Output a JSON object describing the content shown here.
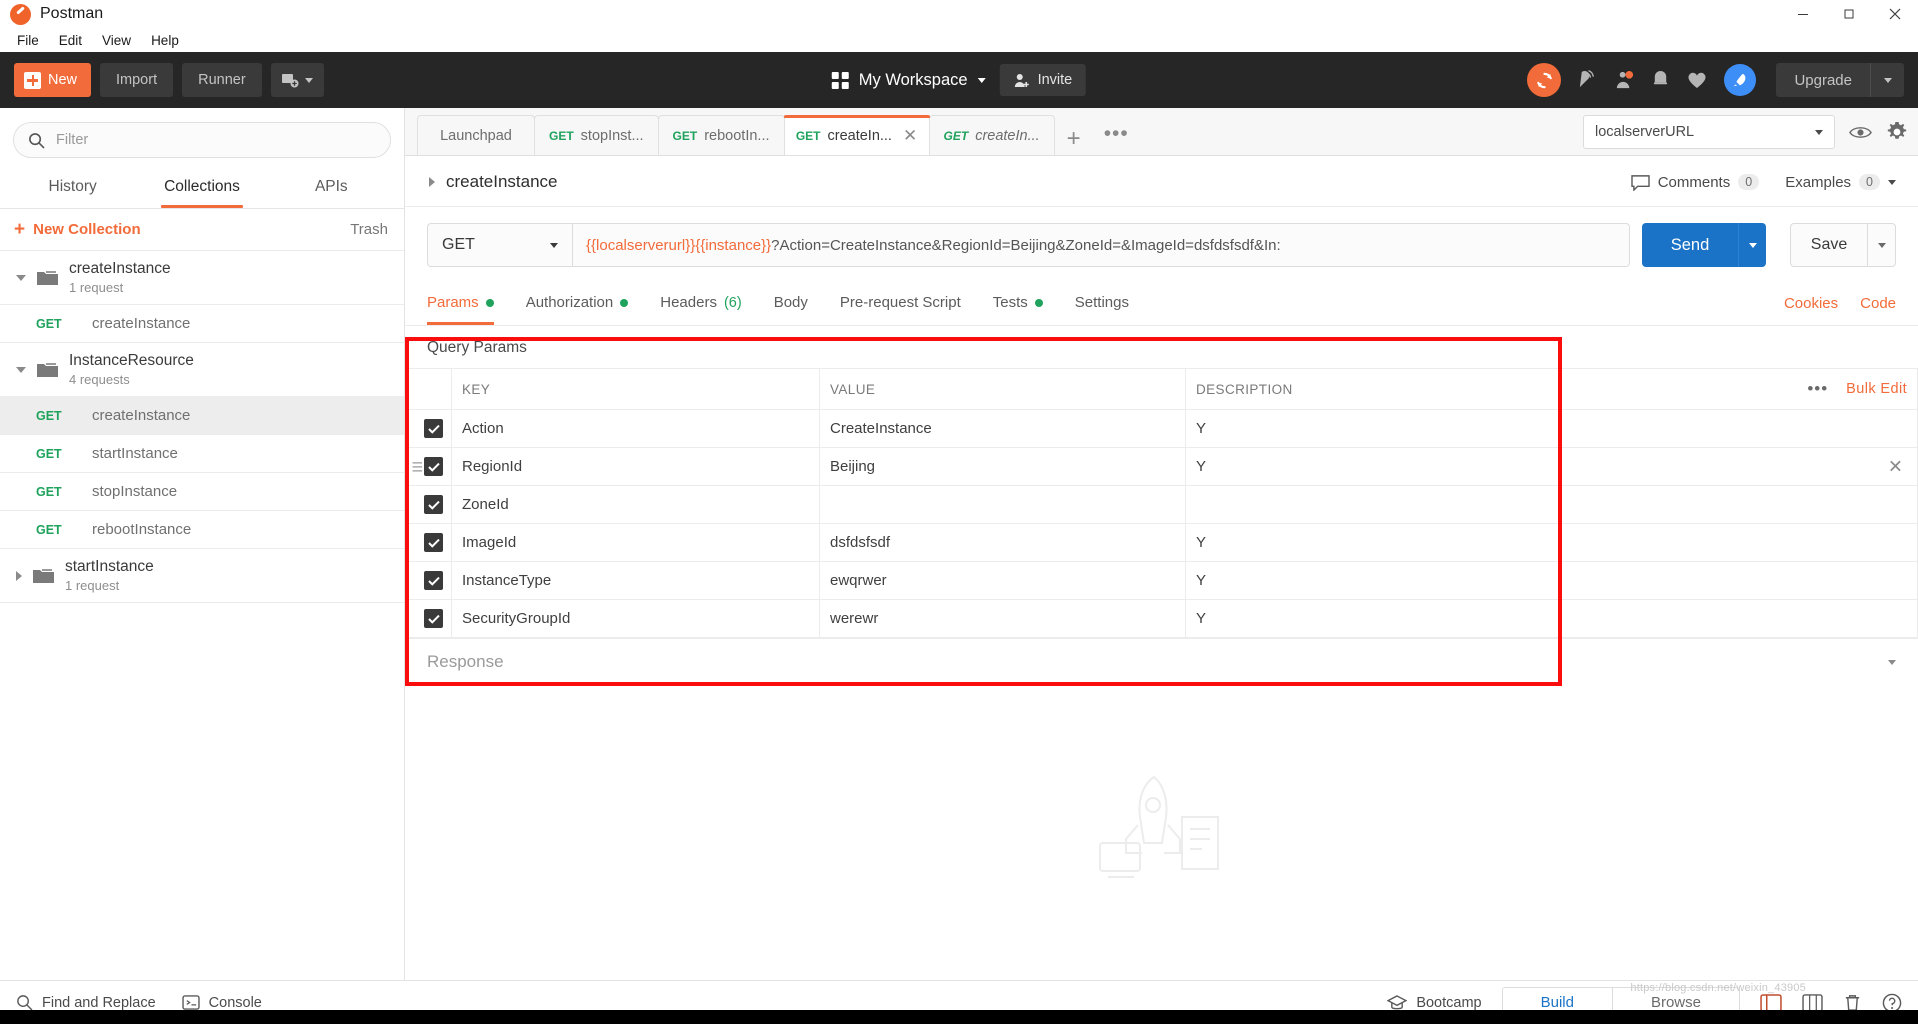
{
  "window": {
    "app_title": "Postman",
    "logo_icon": "postman-logo-icon",
    "minimize": "—",
    "maximize": "❐",
    "close": "✕"
  },
  "menubar": {
    "items": [
      "File",
      "Edit",
      "View",
      "Help"
    ]
  },
  "toolbar": {
    "new_label": "New",
    "import_label": "Import",
    "runner_label": "Runner",
    "workspace_label": "My Workspace",
    "invite_label": "Invite",
    "upgrade_label": "Upgrade",
    "icons": [
      "sync-icon",
      "satellite-icon",
      "notifications-icon",
      "bell-icon",
      "heart-icon",
      "rocket-icon"
    ],
    "accent_color": "#f26b3a"
  },
  "sidebar": {
    "filter_placeholder": "Filter",
    "filter_value": "",
    "tabs": [
      {
        "label": "History",
        "active": false
      },
      {
        "label": "Collections",
        "active": true
      },
      {
        "label": "APIs",
        "active": false
      }
    ],
    "new_collection_label": "New Collection",
    "trash_label": "Trash",
    "tree": [
      {
        "type": "folder",
        "name": "createInstance",
        "sub": "1 request",
        "expanded": true
      },
      {
        "type": "request",
        "method": "GET",
        "name": "createInstance",
        "selected": false
      },
      {
        "type": "folder",
        "name": "InstanceResource",
        "sub": "4 requests",
        "expanded": true
      },
      {
        "type": "request",
        "method": "GET",
        "name": "createInstance",
        "selected": true
      },
      {
        "type": "request",
        "method": "GET",
        "name": "startInstance",
        "selected": false
      },
      {
        "type": "request",
        "method": "GET",
        "name": "stopInstance",
        "selected": false
      },
      {
        "type": "request",
        "method": "GET",
        "name": "rebootInstance",
        "selected": false
      },
      {
        "type": "folder",
        "name": "startInstance",
        "sub": "1 request",
        "expanded": false
      }
    ]
  },
  "main": {
    "request_tabs": [
      {
        "label": "Launchpad",
        "method": "",
        "active": false,
        "italic": false,
        "closable": false
      },
      {
        "label": "stopInst...",
        "method": "GET",
        "active": false,
        "italic": false,
        "closable": false
      },
      {
        "label": "rebootIn...",
        "method": "GET",
        "active": false,
        "italic": false,
        "closable": false
      },
      {
        "label": "createIn...",
        "method": "GET",
        "active": true,
        "italic": false,
        "closable": true
      },
      {
        "label": "createIn...",
        "method": "GET",
        "active": false,
        "italic": true,
        "closable": false
      }
    ],
    "add_tab_label": "+",
    "more_tabs_label": "•••",
    "environment": {
      "selected": "localserverURL",
      "eye_icon": "eye-icon",
      "settings_icon": "gear-icon"
    },
    "request_title": "createInstance",
    "comments_label": "Comments",
    "comments_count": "0",
    "examples_label": "Examples",
    "examples_count": "0",
    "method": "GET",
    "url_prefix_vars": "{{localserverurl}}{{instance}}",
    "url_rest": "?Action=CreateInstance&RegionId=Beijing&ZoneId=&ImageId=dsfdsfsdf&In:",
    "send_label": "Send",
    "save_label": "Save",
    "request_tabs_row": [
      {
        "label": "Params",
        "badge": "dot",
        "active": true
      },
      {
        "label": "Authorization",
        "badge": "dot",
        "active": false
      },
      {
        "label": "Headers",
        "badge": "(6)",
        "active": false
      },
      {
        "label": "Body",
        "badge": "",
        "active": false
      },
      {
        "label": "Pre-request Script",
        "badge": "",
        "active": false
      },
      {
        "label": "Tests",
        "badge": "dot",
        "active": false
      },
      {
        "label": "Settings",
        "badge": "",
        "active": false
      }
    ],
    "cookies_label": "Cookies",
    "code_label": "Code"
  },
  "params": {
    "section_title": "Query Params",
    "columns": [
      "KEY",
      "VALUE",
      "DESCRIPTION"
    ],
    "bulk_edit_label": "Bulk Edit",
    "more_label": "•••",
    "rows": [
      {
        "checked": true,
        "key": "Action",
        "value": "CreateInstance",
        "description": "Y",
        "hovered": false
      },
      {
        "checked": true,
        "key": "RegionId",
        "value": "Beijing",
        "description": "Y",
        "hovered": true
      },
      {
        "checked": true,
        "key": "ZoneId",
        "value": "",
        "description": "",
        "hovered": false
      },
      {
        "checked": true,
        "key": "ImageId",
        "value": "dsfdsfsdf",
        "description": "Y",
        "hovered": false
      },
      {
        "checked": true,
        "key": "InstanceType",
        "value": "ewqrwer",
        "description": "Y",
        "hovered": false
      },
      {
        "checked": true,
        "key": "SecurityGroupId",
        "value": "werewr",
        "description": "Y",
        "hovered": false
      }
    ],
    "highlight_color": "#fb0d0d"
  },
  "response": {
    "label": "Response"
  },
  "statusbar": {
    "find_replace_label": "Find and Replace",
    "console_label": "Console",
    "bootcamp_label": "Bootcamp",
    "build_label": "Build",
    "browse_label": "Browse",
    "icons": [
      "runner-icon",
      "grid-icon",
      "trash-icon",
      "help-icon"
    ]
  },
  "watermark": "https://blog.csdn.net/weixin_43905"
}
